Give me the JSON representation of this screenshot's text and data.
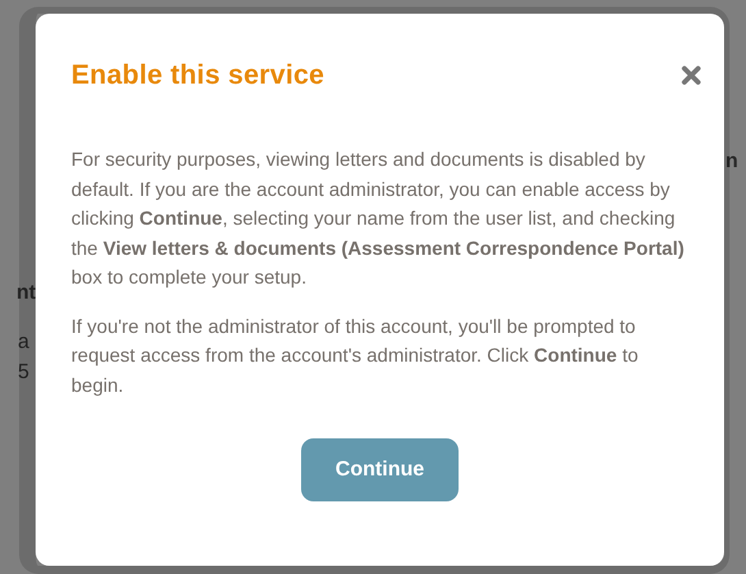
{
  "background": {
    "fragments": [
      {
        "text": "nt",
        "bold": true
      },
      {
        "text": "a",
        "bold": false
      },
      {
        "text": "5",
        "bold": false
      },
      {
        "text": "n",
        "bold": true
      }
    ]
  },
  "dialog": {
    "title": "Enable this service",
    "paragraphs": [
      "For security purposes, viewing letters and documents is disabled by default. If you are the account administrator, you can enable access by clicking **Continue**, selecting your name from the user list, and checking the **View letters & documents (Assessment Correspondence Portal)** box to complete your setup.",
      "If you're not the administrator of this account, you'll be prompted to request access from the account's administrator. Click **Continue** to begin."
    ],
    "button": "Continue"
  }
}
